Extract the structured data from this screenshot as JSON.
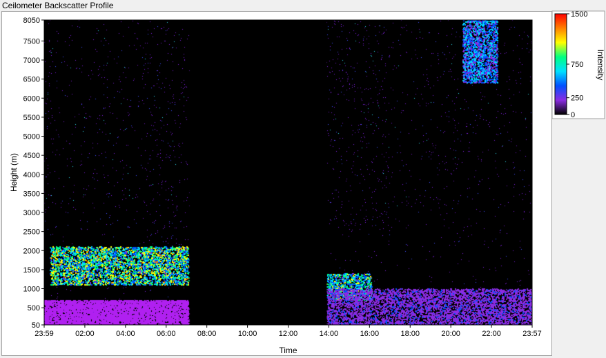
{
  "window": {
    "title": "Ceilometer Backscatter Profile"
  },
  "chart_data": {
    "type": "heatmap",
    "title": "Ceilometer Backscatter Profile",
    "xlabel": "Time",
    "ylabel": "Height (m)",
    "x_ticks": [
      "23:59",
      "02:00",
      "04:00",
      "06:00",
      "08:00",
      "10:00",
      "12:00",
      "14:00",
      "16:00",
      "18:00",
      "20:00",
      "22:00",
      "23:57"
    ],
    "x_tick_hours": [
      0,
      2,
      4,
      6,
      8,
      10,
      12,
      14,
      16,
      18,
      20,
      22,
      24
    ],
    "y_ticks": [
      50,
      500,
      1000,
      1500,
      2000,
      2500,
      3000,
      3500,
      4000,
      4500,
      5000,
      5500,
      6000,
      6500,
      7000,
      7500,
      8050
    ],
    "ylim": [
      50,
      8050
    ],
    "xlim_hours": [
      0,
      24
    ],
    "no_data_gap": {
      "start_hour": 7.15,
      "end_hour": 13.9
    },
    "colorbar": {
      "label": "Intensity",
      "ticks": [
        0,
        250,
        750,
        1500
      ],
      "range": [
        0,
        1500
      ],
      "colors": [
        "#000000",
        "#8a2be2",
        "#0050ff",
        "#00e0ff",
        "#00ff80",
        "#ffff00",
        "#ff8000",
        "#ff0000"
      ]
    },
    "features": [
      {
        "name": "cloud_layer_night",
        "start_hour": 0.3,
        "end_hour": 7.1,
        "height_m": [
          1100,
          2100
        ],
        "intensity": 1000
      },
      {
        "name": "cloud_layer_afternoon",
        "start_hour": 13.9,
        "end_hour": 16.1,
        "height_m": [
          700,
          1400
        ],
        "intensity": 900
      },
      {
        "name": "high_cloud",
        "start_hour": 20.6,
        "end_hour": 22.3,
        "height_m": [
          6400,
          8050
        ],
        "intensity": 600
      },
      {
        "name": "boundary_layer",
        "start_hour": 13.9,
        "end_hour": 24,
        "height_m": [
          50,
          1000
        ],
        "intensity": 300
      }
    ],
    "grid": false,
    "legend": "right"
  }
}
